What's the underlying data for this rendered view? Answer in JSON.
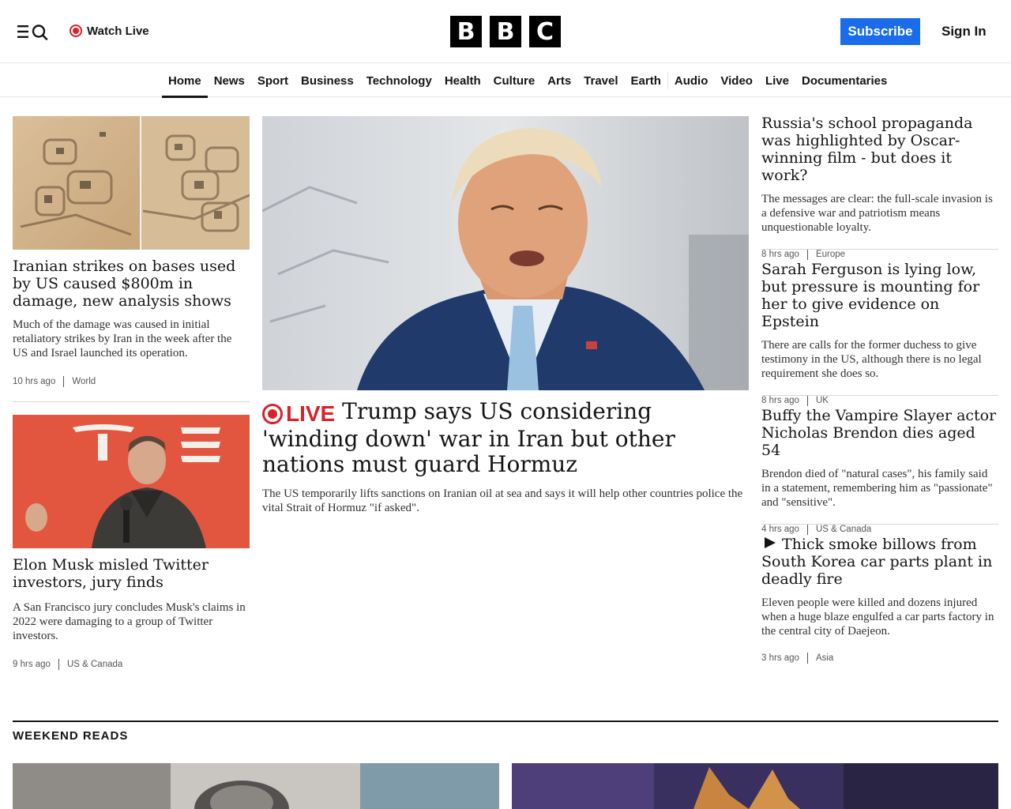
{
  "header": {
    "watch_live": "Watch Live",
    "logo_letters": [
      "B",
      "B",
      "C"
    ],
    "subscribe": "Subscribe",
    "sign_in": "Sign In"
  },
  "nav": {
    "items": [
      "Home",
      "News",
      "Sport",
      "Business",
      "Technology",
      "Health",
      "Culture",
      "Arts",
      "Travel",
      "Earth",
      "Audio",
      "Video",
      "Live",
      "Documentaries"
    ],
    "active": "Home"
  },
  "left_stories": [
    {
      "headline": "Iranian strikes on bases used by US caused $800m in damage, new analysis shows",
      "summary": "Much of the damage was caused in initial retaliatory strikes by Iran in the week after the US and Israel launched its operation.",
      "time": "10 hrs ago",
      "category": "World"
    },
    {
      "headline": "Elon Musk misled Twitter investors, jury finds",
      "summary": "A San Francisco jury concludes Musk's claims in 2022 were damaging to a group of Twitter investors.",
      "time": "9 hrs ago",
      "category": "US & Canada"
    }
  ],
  "main_story": {
    "live_label": "LIVE",
    "headline": "Trump says US considering 'winding down' war in Iran but other nations must guard Hormuz",
    "summary": "The US temporarily lifts sanctions on Iranian oil at sea and says it will help other countries police the vital Strait of Hormuz \"if asked\"."
  },
  "right_stories": [
    {
      "headline": "Russia's school propaganda was highlighted by Oscar-winning film - but does it work?",
      "summary": "The messages are clear: the full-scale invasion is a defensive war and patriotism means unquestionable loyalty.",
      "time": "8 hrs ago",
      "category": "Europe"
    },
    {
      "headline": "Sarah Ferguson is lying low, but pressure is mounting for her to give evidence on Epstein",
      "summary": "There are calls for the former duchess to give testimony in the US, although there is no legal requirement she does so.",
      "time": "8 hrs ago",
      "category": "UK"
    },
    {
      "headline": "Buffy the Vampire Slayer actor Nicholas Brendon dies aged 54",
      "summary": "Brendon died of \"natural cases\", his family said in a statement, remembering him as \"passionate\" and \"sensitive\".",
      "time": "4 hrs ago",
      "category": "US & Canada"
    },
    {
      "headline": "Thick smoke billows from South Korea car parts plant in deadly fire",
      "summary": "Eleven people were killed and dozens injured when a huge blaze engulfed a car parts factory in the central city of Daejeon.",
      "time": "3 hrs ago",
      "category": "Asia"
    }
  ],
  "weekend_reads": {
    "title": "WEEKEND READS"
  },
  "colors": {
    "accent_blue": "#1a6cea",
    "live_red": "#d5232a",
    "text": "#141414"
  }
}
